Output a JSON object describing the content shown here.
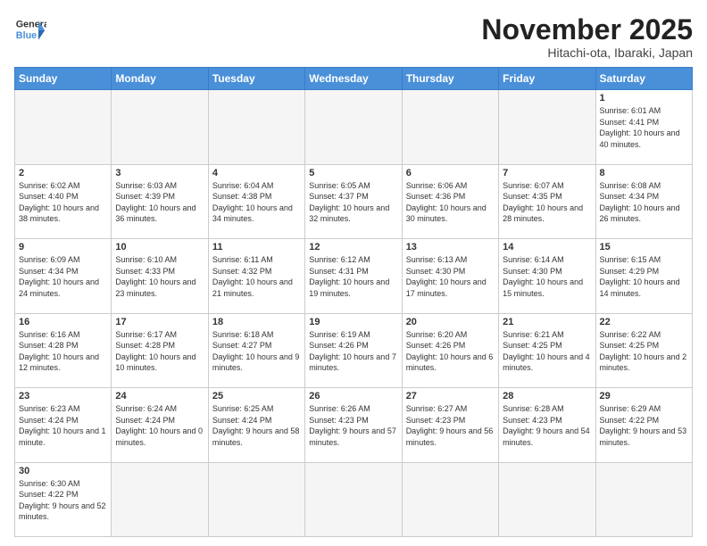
{
  "logo": {
    "text_general": "General",
    "text_blue": "Blue"
  },
  "title": "November 2025",
  "location": "Hitachi-ota, Ibaraki, Japan",
  "days_of_week": [
    "Sunday",
    "Monday",
    "Tuesday",
    "Wednesday",
    "Thursday",
    "Friday",
    "Saturday"
  ],
  "weeks": [
    [
      {
        "day": "",
        "info": ""
      },
      {
        "day": "",
        "info": ""
      },
      {
        "day": "",
        "info": ""
      },
      {
        "day": "",
        "info": ""
      },
      {
        "day": "",
        "info": ""
      },
      {
        "day": "",
        "info": ""
      },
      {
        "day": "1",
        "info": "Sunrise: 6:01 AM\nSunset: 4:41 PM\nDaylight: 10 hours and 40 minutes."
      }
    ],
    [
      {
        "day": "2",
        "info": "Sunrise: 6:02 AM\nSunset: 4:40 PM\nDaylight: 10 hours and 38 minutes."
      },
      {
        "day": "3",
        "info": "Sunrise: 6:03 AM\nSunset: 4:39 PM\nDaylight: 10 hours and 36 minutes."
      },
      {
        "day": "4",
        "info": "Sunrise: 6:04 AM\nSunset: 4:38 PM\nDaylight: 10 hours and 34 minutes."
      },
      {
        "day": "5",
        "info": "Sunrise: 6:05 AM\nSunset: 4:37 PM\nDaylight: 10 hours and 32 minutes."
      },
      {
        "day": "6",
        "info": "Sunrise: 6:06 AM\nSunset: 4:36 PM\nDaylight: 10 hours and 30 minutes."
      },
      {
        "day": "7",
        "info": "Sunrise: 6:07 AM\nSunset: 4:35 PM\nDaylight: 10 hours and 28 minutes."
      },
      {
        "day": "8",
        "info": "Sunrise: 6:08 AM\nSunset: 4:34 PM\nDaylight: 10 hours and 26 minutes."
      }
    ],
    [
      {
        "day": "9",
        "info": "Sunrise: 6:09 AM\nSunset: 4:34 PM\nDaylight: 10 hours and 24 minutes."
      },
      {
        "day": "10",
        "info": "Sunrise: 6:10 AM\nSunset: 4:33 PM\nDaylight: 10 hours and 23 minutes."
      },
      {
        "day": "11",
        "info": "Sunrise: 6:11 AM\nSunset: 4:32 PM\nDaylight: 10 hours and 21 minutes."
      },
      {
        "day": "12",
        "info": "Sunrise: 6:12 AM\nSunset: 4:31 PM\nDaylight: 10 hours and 19 minutes."
      },
      {
        "day": "13",
        "info": "Sunrise: 6:13 AM\nSunset: 4:30 PM\nDaylight: 10 hours and 17 minutes."
      },
      {
        "day": "14",
        "info": "Sunrise: 6:14 AM\nSunset: 4:30 PM\nDaylight: 10 hours and 15 minutes."
      },
      {
        "day": "15",
        "info": "Sunrise: 6:15 AM\nSunset: 4:29 PM\nDaylight: 10 hours and 14 minutes."
      }
    ],
    [
      {
        "day": "16",
        "info": "Sunrise: 6:16 AM\nSunset: 4:28 PM\nDaylight: 10 hours and 12 minutes."
      },
      {
        "day": "17",
        "info": "Sunrise: 6:17 AM\nSunset: 4:28 PM\nDaylight: 10 hours and 10 minutes."
      },
      {
        "day": "18",
        "info": "Sunrise: 6:18 AM\nSunset: 4:27 PM\nDaylight: 10 hours and 9 minutes."
      },
      {
        "day": "19",
        "info": "Sunrise: 6:19 AM\nSunset: 4:26 PM\nDaylight: 10 hours and 7 minutes."
      },
      {
        "day": "20",
        "info": "Sunrise: 6:20 AM\nSunset: 4:26 PM\nDaylight: 10 hours and 6 minutes."
      },
      {
        "day": "21",
        "info": "Sunrise: 6:21 AM\nSunset: 4:25 PM\nDaylight: 10 hours and 4 minutes."
      },
      {
        "day": "22",
        "info": "Sunrise: 6:22 AM\nSunset: 4:25 PM\nDaylight: 10 hours and 2 minutes."
      }
    ],
    [
      {
        "day": "23",
        "info": "Sunrise: 6:23 AM\nSunset: 4:24 PM\nDaylight: 10 hours and 1 minute."
      },
      {
        "day": "24",
        "info": "Sunrise: 6:24 AM\nSunset: 4:24 PM\nDaylight: 10 hours and 0 minutes."
      },
      {
        "day": "25",
        "info": "Sunrise: 6:25 AM\nSunset: 4:24 PM\nDaylight: 9 hours and 58 minutes."
      },
      {
        "day": "26",
        "info": "Sunrise: 6:26 AM\nSunset: 4:23 PM\nDaylight: 9 hours and 57 minutes."
      },
      {
        "day": "27",
        "info": "Sunrise: 6:27 AM\nSunset: 4:23 PM\nDaylight: 9 hours and 56 minutes."
      },
      {
        "day": "28",
        "info": "Sunrise: 6:28 AM\nSunset: 4:23 PM\nDaylight: 9 hours and 54 minutes."
      },
      {
        "day": "29",
        "info": "Sunrise: 6:29 AM\nSunset: 4:22 PM\nDaylight: 9 hours and 53 minutes."
      }
    ],
    [
      {
        "day": "30",
        "info": "Sunrise: 6:30 AM\nSunset: 4:22 PM\nDaylight: 9 hours and 52 minutes."
      },
      {
        "day": "",
        "info": ""
      },
      {
        "day": "",
        "info": ""
      },
      {
        "day": "",
        "info": ""
      },
      {
        "day": "",
        "info": ""
      },
      {
        "day": "",
        "info": ""
      },
      {
        "day": "",
        "info": ""
      }
    ]
  ]
}
